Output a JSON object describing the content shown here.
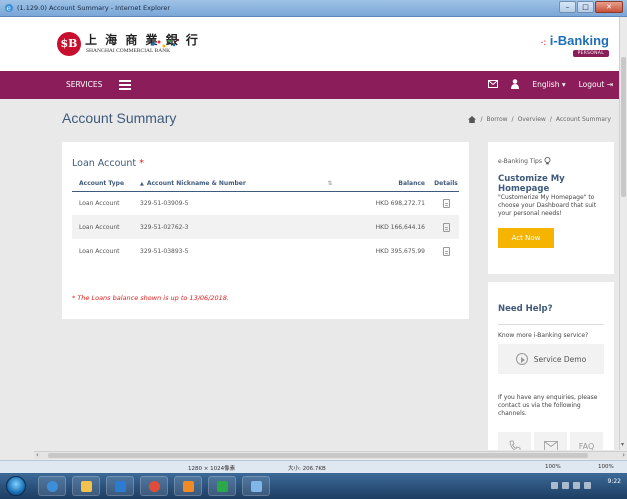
{
  "window": {
    "title": "(1.129.0) Account Summary - Internet Explorer"
  },
  "bank": {
    "logo_letter": "$B",
    "name_cn": "上 海 商 業 銀 行",
    "name_en": "SHANGHAI COMMERCIAL BANK",
    "ibanking": "i-Banking",
    "ibanking_badge": "PERSONAL"
  },
  "nav": {
    "services": "SERVICES",
    "language": "English",
    "logout": "Logout"
  },
  "page": {
    "title": "Account Summary",
    "breadcrumb": [
      "Borrow",
      "Overview",
      "Account Summary"
    ]
  },
  "loan": {
    "title": "Loan Account",
    "required_mark": "*",
    "columns": [
      "Account Type",
      "Account Nickname & Number",
      "Balance",
      "Details"
    ],
    "rows": [
      {
        "type": "Loan Account",
        "number": "329-51-03909-5",
        "balance": "HKD 698,272.71"
      },
      {
        "type": "Loan Account",
        "number": "329-51-02762-3",
        "balance": "HKD 166,644.16"
      },
      {
        "type": "Loan Account",
        "number": "329-51-03893-5",
        "balance": "HKD 395,675.99"
      }
    ],
    "note": "* The Loans balance shown is up to 13/06/2018."
  },
  "tips": {
    "label": "e-Banking Tips",
    "heading": "Customize My Homepage",
    "text": "\"Customerize My Homepage\" to choose your Dashboard that suit your personal needs!",
    "button": "Act Now"
  },
  "help": {
    "heading": "Need Help?",
    "know_more": "Know more i-Banking service?",
    "demo": "Service Demo",
    "enquiry": "If you have any enquiries, please contact us via the following channels.",
    "faq": "FAQ"
  },
  "status": {
    "dims": "1280 × 1024像素",
    "size": "大小: 206.7KB",
    "zoom": "100%",
    "zoom_right": "100%"
  },
  "taskbar": {
    "time": "9:22"
  },
  "colors": {
    "brand": "#8a1d5a",
    "accent": "#f5b400",
    "heading": "#3f5a7b",
    "alert": "#e02020"
  }
}
